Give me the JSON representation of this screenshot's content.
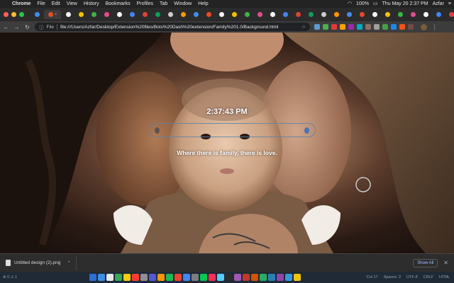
{
  "menubar": {
    "app": "Chrome",
    "items": [
      "File",
      "Edit",
      "View",
      "History",
      "Bookmarks",
      "Profiles",
      "Tab",
      "Window",
      "Help"
    ],
    "battery": "100%",
    "datetime": "Thu May 20  2:37 PM",
    "user": "Azfar"
  },
  "tabstrip": {
    "tab_count": 44,
    "new_tab_label": "+"
  },
  "toolbar": {
    "scheme_label": "File",
    "url": "file:///Users/Azfar/Desktop/Extension%20files/Bots%20Dash%20extension/Family%201.0/Background.html"
  },
  "page": {
    "time": "2:37:43 PM",
    "quote": "Where there is family, there is love.",
    "photo_subject": "family-photo"
  },
  "downloads": {
    "file_name": "Untitled design (2).png",
    "show_all_label": "Show All"
  },
  "statusbar": {
    "left": "⊗ 0 ⚠ 1",
    "right": [
      "Col 17",
      "Spaces: 2",
      "UTF-8",
      "CRLF",
      "HTML"
    ]
  },
  "colors": {
    "traffic_red": "#ff5f57",
    "traffic_yellow": "#febc2e",
    "traffic_green": "#28c840",
    "link_blue": "#9ec1ff"
  }
}
